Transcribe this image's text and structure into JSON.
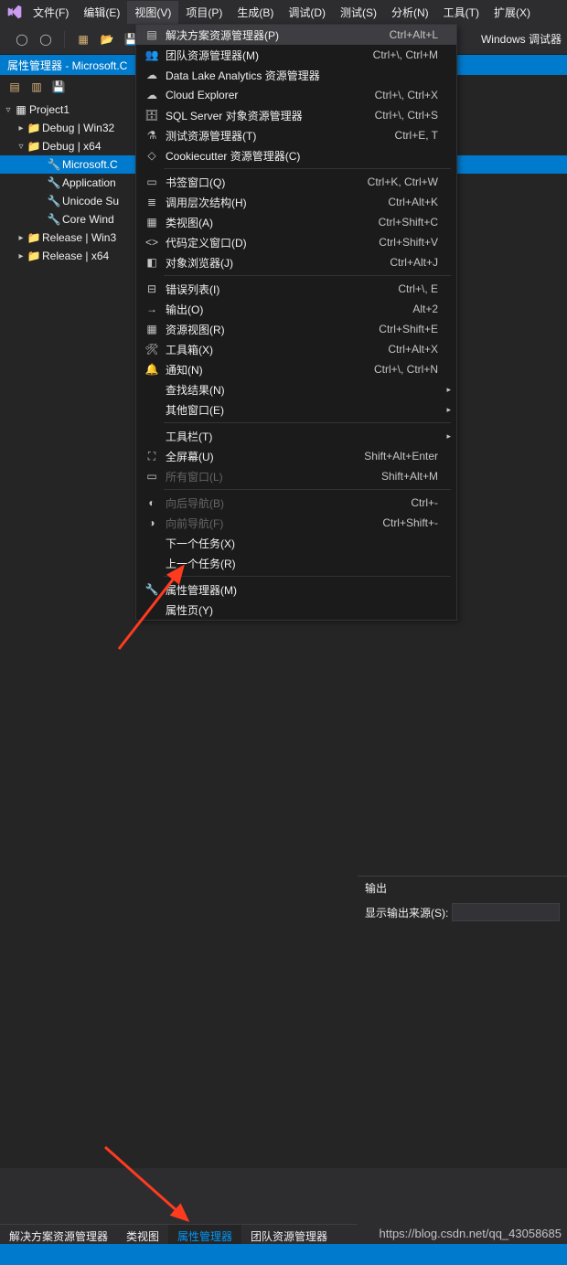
{
  "menubar": {
    "items": [
      "文件(F)",
      "编辑(E)",
      "视图(V)",
      "项目(P)",
      "生成(B)",
      "调试(D)",
      "测试(S)",
      "分析(N)",
      "工具(T)",
      "扩展(X)"
    ],
    "active": 2
  },
  "toolbar": {
    "right_label": "Windows 调试器"
  },
  "panel": {
    "title": "属性管理器 - Microsoft.C",
    "tree": [
      {
        "depth": 0,
        "caret": "▿",
        "icon": "project",
        "label": "Project1"
      },
      {
        "depth": 1,
        "caret": "▸",
        "icon": "folder",
        "label": "Debug | Win32"
      },
      {
        "depth": 1,
        "caret": "▿",
        "icon": "folder",
        "label": "Debug | x64"
      },
      {
        "depth": 2,
        "caret": "",
        "icon": "wrench",
        "label": "Microsoft.C",
        "selected": true
      },
      {
        "depth": 2,
        "caret": "",
        "icon": "wrench",
        "label": "Application"
      },
      {
        "depth": 2,
        "caret": "",
        "icon": "wrench",
        "label": "Unicode Su"
      },
      {
        "depth": 2,
        "caret": "",
        "icon": "wrench",
        "label": "Core Wind"
      },
      {
        "depth": 1,
        "caret": "▸",
        "icon": "folder",
        "label": "Release | Win3"
      },
      {
        "depth": 1,
        "caret": "▸",
        "icon": "folder",
        "label": "Release | x64"
      }
    ]
  },
  "dropdown": {
    "groups": [
      [
        {
          "icon": "list",
          "label": "解决方案资源管理器(P)",
          "shortcut": "Ctrl+Alt+L",
          "highlight": true
        },
        {
          "icon": "team",
          "label": "团队资源管理器(M)",
          "shortcut": "Ctrl+\\, Ctrl+M"
        },
        {
          "icon": "cloud",
          "label": "Data Lake Analytics 资源管理器",
          "shortcut": ""
        },
        {
          "icon": "cloud",
          "label": "Cloud Explorer",
          "shortcut": "Ctrl+\\, Ctrl+X"
        },
        {
          "icon": "db",
          "label": "SQL Server 对象资源管理器",
          "shortcut": "Ctrl+\\, Ctrl+S"
        },
        {
          "icon": "flask",
          "label": "测试资源管理器(T)",
          "shortcut": "Ctrl+E, T"
        },
        {
          "icon": "cookie",
          "label": "Cookiecutter 资源管理器(C)",
          "shortcut": ""
        }
      ],
      [
        {
          "icon": "book",
          "label": "书签窗口(Q)",
          "shortcut": "Ctrl+K, Ctrl+W"
        },
        {
          "icon": "layers",
          "label": "调用层次结构(H)",
          "shortcut": "Ctrl+Alt+K"
        },
        {
          "icon": "class",
          "label": "类视图(A)",
          "shortcut": "Ctrl+Shift+C"
        },
        {
          "icon": "code",
          "label": "代码定义窗口(D)",
          "shortcut": "Ctrl+Shift+V"
        },
        {
          "icon": "obj",
          "label": "对象浏览器(J)",
          "shortcut": "Ctrl+Alt+J"
        }
      ],
      [
        {
          "icon": "error",
          "label": "错误列表(I)",
          "shortcut": "Ctrl+\\, E"
        },
        {
          "icon": "output",
          "label": "输出(O)",
          "shortcut": "Alt+2"
        },
        {
          "icon": "res",
          "label": "资源视图(R)",
          "shortcut": "Ctrl+Shift+E"
        },
        {
          "icon": "tool",
          "label": "工具箱(X)",
          "shortcut": "Ctrl+Alt+X"
        },
        {
          "icon": "bell",
          "label": "通知(N)",
          "shortcut": "Ctrl+\\, Ctrl+N"
        },
        {
          "icon": "",
          "label": "查找结果(N)",
          "shortcut": "",
          "submenu": true
        },
        {
          "icon": "",
          "label": "其他窗口(E)",
          "shortcut": "",
          "submenu": true
        }
      ],
      [
        {
          "icon": "",
          "label": "工具栏(T)",
          "shortcut": "",
          "submenu": true
        },
        {
          "icon": "full",
          "label": "全屏幕(U)",
          "shortcut": "Shift+Alt+Enter"
        },
        {
          "icon": "win",
          "label": "所有窗口(L)",
          "shortcut": "Shift+Alt+M",
          "disabled": true
        }
      ],
      [
        {
          "icon": "back",
          "label": "向后导航(B)",
          "shortcut": "Ctrl+-",
          "disabled": true
        },
        {
          "icon": "fwd",
          "label": "向前导航(F)",
          "shortcut": "Ctrl+Shift+-",
          "disabled": true
        },
        {
          "icon": "",
          "label": "下一个任务(X)",
          "shortcut": ""
        },
        {
          "icon": "",
          "label": "上一个任务(R)",
          "shortcut": ""
        }
      ],
      [
        {
          "icon": "wrench",
          "label": "属性管理器(M)",
          "shortcut": ""
        },
        {
          "icon": "",
          "label": "属性页(Y)",
          "shortcut": ""
        }
      ]
    ]
  },
  "output": {
    "title": "输出",
    "source_label": "显示输出来源(S):"
  },
  "bottom_tabs": [
    "解决方案资源管理器",
    "类视图",
    "属性管理器",
    "团队资源管理器"
  ],
  "bottom_active": 2,
  "status": {
    "left": ""
  },
  "watermark": "https://blog.csdn.net/qq_43058685"
}
